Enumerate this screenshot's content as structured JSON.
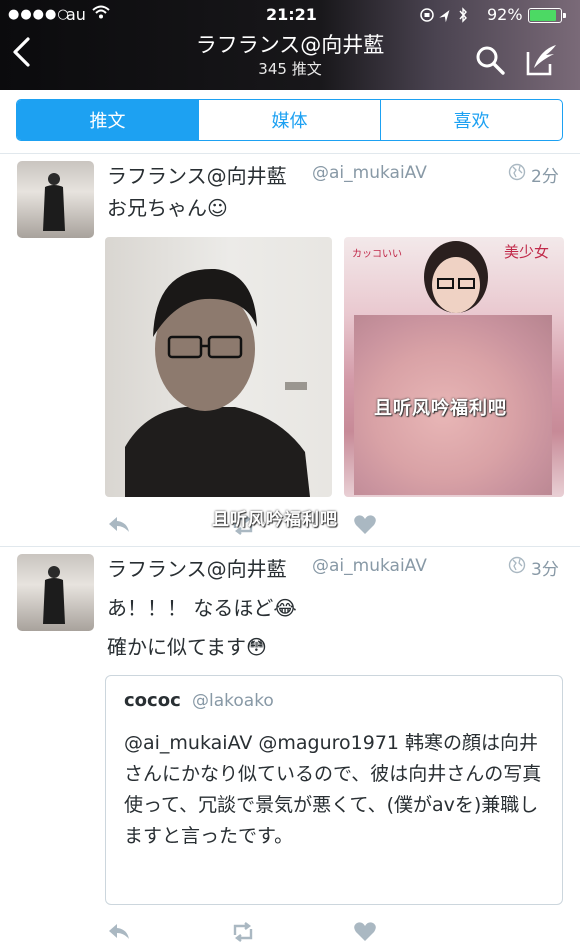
{
  "status_bar": {
    "signal": "●●●●○",
    "carrier": "au",
    "time": "21:21",
    "battery_pct": "92%",
    "battery_level": 0.92
  },
  "header": {
    "title": "ラフランス@向井藍",
    "subtitle": "345 推文"
  },
  "tabs": [
    {
      "label": "推文",
      "active": true
    },
    {
      "label": "媒体",
      "active": false
    },
    {
      "label": "喜欢",
      "active": false
    }
  ],
  "tweets": [
    {
      "name": "ラフランス@向井藍",
      "handle": "@ai_mukaiAV",
      "time_ago": "2分",
      "lines": [
        "お兄ちゃん☺"
      ],
      "media_watermark": "且听风吟福利吧",
      "footer_watermark": "且听风吟福利吧"
    },
    {
      "name": "ラフランス@向井藍",
      "handle": "@ai_mukaiAV",
      "time_ago": "3分",
      "lines": [
        "あ！！！ なるほど😂",
        "確かに似てます😳"
      ],
      "quote": {
        "name": "cococ",
        "handle": "@lakoako",
        "text": "@ai_mukaiAV @maguro1971 韩寒の顔は向井さんにかなり似ているので、彼は向井さんの写真使って、冗談で景気が悪くて、(僕がavを)兼職しますと言ったです。"
      }
    }
  ],
  "colors": {
    "accent": "#1da1f2",
    "text": "#292f33",
    "muted": "#8899a6",
    "icon": "#aab8c2"
  }
}
